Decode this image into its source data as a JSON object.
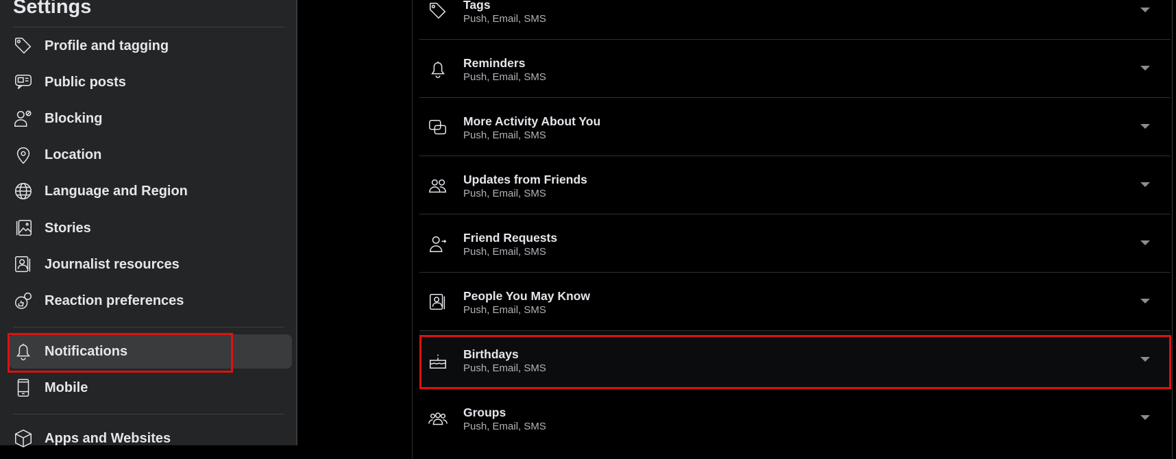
{
  "sidebar": {
    "title": "Settings",
    "items": [
      {
        "label": "Profile and tagging",
        "icon": "tag-icon"
      },
      {
        "label": "Public posts",
        "icon": "public-posts-icon"
      },
      {
        "label": "Blocking",
        "icon": "blocking-icon"
      },
      {
        "label": "Location",
        "icon": "location-pin-icon"
      },
      {
        "label": "Language and Region",
        "icon": "globe-icon"
      },
      {
        "label": "Stories",
        "icon": "stories-icon"
      },
      {
        "label": "Journalist resources",
        "icon": "journalist-icon"
      },
      {
        "label": "Reaction preferences",
        "icon": "reaction-icon"
      },
      {
        "label": "Notifications",
        "icon": "bell-icon",
        "active": true
      },
      {
        "label": "Mobile",
        "icon": "mobile-icon"
      },
      {
        "label": "Apps and Websites",
        "icon": "cube-icon"
      }
    ]
  },
  "notifications": {
    "rows": [
      {
        "title": "Tags",
        "subtitle": "Push, Email, SMS",
        "icon": "tag-icon"
      },
      {
        "title": "Reminders",
        "subtitle": "Push, Email, SMS",
        "icon": "bell-icon"
      },
      {
        "title": "More Activity About You",
        "subtitle": "Push, Email, SMS",
        "icon": "activity-icon"
      },
      {
        "title": "Updates from Friends",
        "subtitle": "Push, Email, SMS",
        "icon": "friends-icon"
      },
      {
        "title": "Friend Requests",
        "subtitle": "Push, Email, SMS",
        "icon": "friend-request-icon"
      },
      {
        "title": "People You May Know",
        "subtitle": "Push, Email, SMS",
        "icon": "people-icon"
      },
      {
        "title": "Birthdays",
        "subtitle": "Push, Email, SMS",
        "icon": "birthday-cake-icon",
        "highlighted": true
      },
      {
        "title": "Groups",
        "subtitle": "Push, Email, SMS",
        "icon": "groups-icon"
      }
    ]
  },
  "colors": {
    "sidebar_bg": "#242526",
    "active_bg": "#3a3b3c",
    "highlight_box": "#e01010",
    "text": "#e4e6eb",
    "subtext": "#b0b3b8"
  }
}
